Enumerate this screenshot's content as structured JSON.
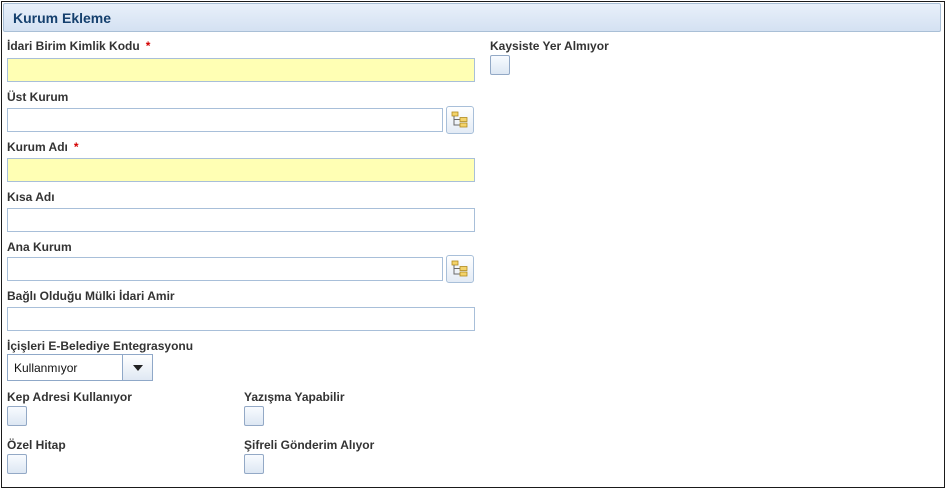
{
  "panel": {
    "title": "Kurum Ekleme"
  },
  "fields": {
    "idari_birim_kimlik_kodu": {
      "label": "İdari Birim Kimlik Kodu",
      "required_mark": "*",
      "value": ""
    },
    "ust_kurum": {
      "label": "Üst Kurum",
      "value": ""
    },
    "kurum_adi": {
      "label": "Kurum Adı",
      "required_mark": "*",
      "value": ""
    },
    "kisa_adi": {
      "label": "Kısa Adı",
      "value": ""
    },
    "ana_kurum": {
      "label": "Ana Kurum",
      "value": ""
    },
    "bagli_oldugu_amir": {
      "label": "Bağlı Olduğu Mülki İdari Amir",
      "value": ""
    },
    "e_belediye": {
      "label": "İçişleri E-Belediye Entegrasyonu",
      "selected": "Kullanmıyor"
    }
  },
  "checkboxes": {
    "kaysiste": {
      "label": "Kaysiste Yer Almıyor",
      "checked": false
    },
    "kep_adresi": {
      "label": "Kep Adresi Kullanıyor",
      "checked": false
    },
    "yazisma": {
      "label": "Yazışma Yapabilir",
      "checked": false
    },
    "ozel_hitap": {
      "label": "Özel Hitap",
      "checked": false
    },
    "sifreli": {
      "label": "Şifreli Gönderim Alıyor",
      "checked": false
    }
  },
  "icons": {
    "picker": "tree-picker-icon",
    "dropdown": "chevron-down-icon"
  },
  "colors": {
    "required_bg": "#ffffb4",
    "header_text": "#15406e",
    "required_mark": "#d40000"
  }
}
